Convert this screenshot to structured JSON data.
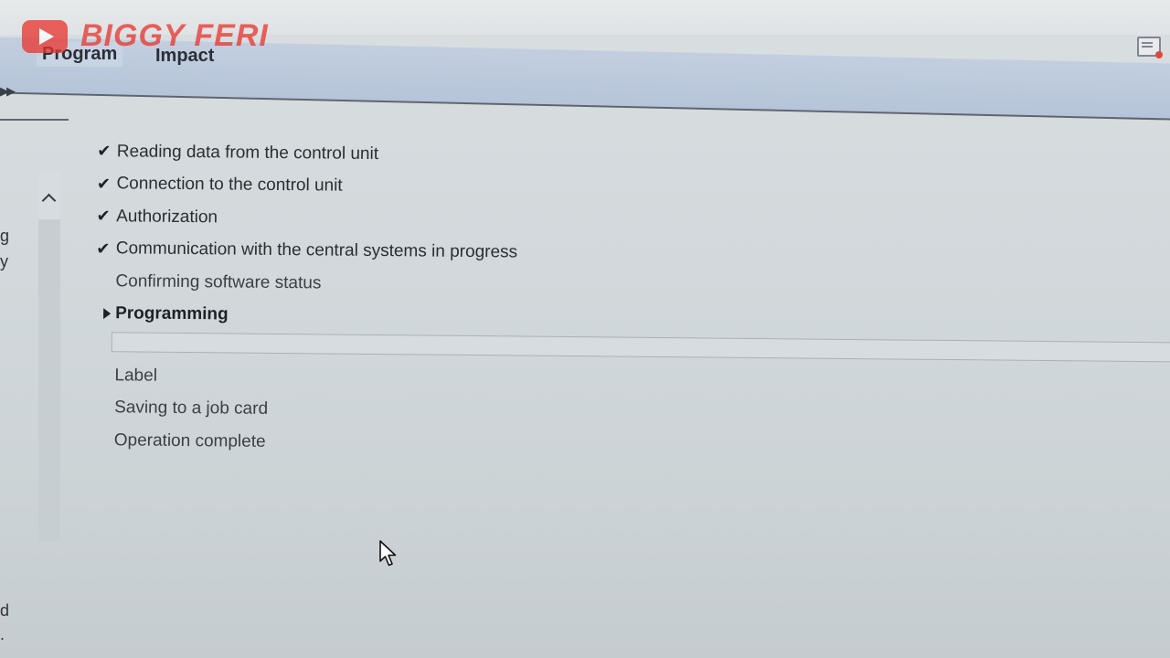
{
  "watermark": {
    "text": "BIGGY FERI"
  },
  "tabs": [
    {
      "label": "Program",
      "active": true
    },
    {
      "label": "Impact",
      "active": false
    }
  ],
  "left_fragments": [
    "g",
    "y",
    "d",
    "."
  ],
  "steps": [
    {
      "label": "Reading data from the control unit",
      "status": "done"
    },
    {
      "label": "Connection to the control unit",
      "status": "done"
    },
    {
      "label": "Authorization",
      "status": "done"
    },
    {
      "label": "Communication with the central systems in progress",
      "status": "done"
    },
    {
      "label": "Confirming software status",
      "status": "pending"
    },
    {
      "label": "Programming",
      "status": "current"
    },
    {
      "label": "Label",
      "status": "pending"
    },
    {
      "label": "Saving to a job card",
      "status": "pending"
    },
    {
      "label": "Operation complete",
      "status": "pending"
    }
  ],
  "programming_progress": 0,
  "icons": {
    "done": "check-icon",
    "current": "caret-right-icon",
    "expand": "double-chevron-right-icon",
    "scroll_up": "chevron-up-icon",
    "message": "message-icon",
    "pointer": "mouse-pointer-icon"
  },
  "colors": {
    "tab_bar": "#b6c4d9",
    "background": "#d3d9dc",
    "watermark": "#e8332c",
    "text": "#2a2e31"
  }
}
